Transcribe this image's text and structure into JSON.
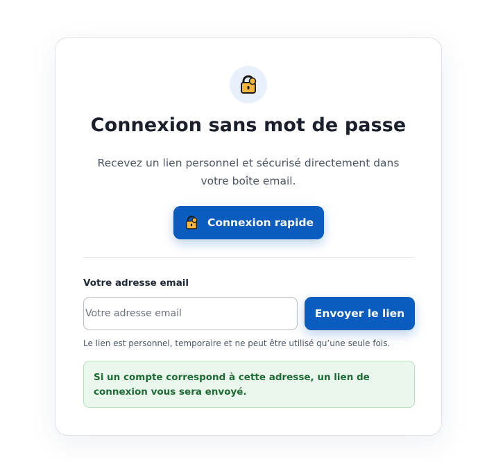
{
  "header": {
    "icon": "lock-icon",
    "title": "Connexion sans mot de passe",
    "subtitle": "Recevez un lien personnel et sécurisé directement dans votre boîte email."
  },
  "quick_login": {
    "icon": "lock-icon",
    "label": "Connexion rapide"
  },
  "form": {
    "email_label": "Votre adresse email",
    "email_placeholder": "Votre adresse email",
    "email_value": "",
    "submit_label": "Envoyer le lien",
    "help_text": "Le lien est personnel, temporaire et ne peut être utilisé qu’une seule fois."
  },
  "alert": {
    "message": "Si un compte correspond à cette adresse, un lien de connexion vous sera envoyé."
  },
  "colors": {
    "primary": "#0b5cbf",
    "lock_body": "#f5b73b",
    "success_bg": "#eaf7ec",
    "success_text": "#1e6b35"
  }
}
